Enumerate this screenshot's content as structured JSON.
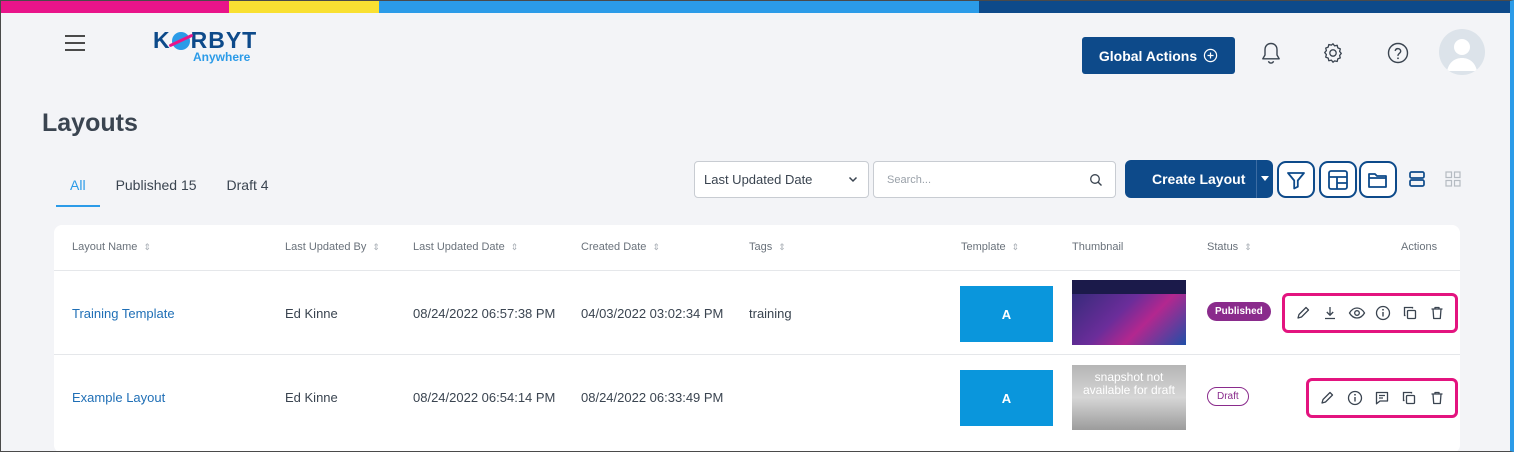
{
  "app": {
    "logo_text_left": "K",
    "logo_text_right": "RBYT",
    "logo_sub": "Anywhere",
    "brand_colors": [
      "#e9148a",
      "#f9e032",
      "#2b9be8",
      "#0d4a8a"
    ]
  },
  "header": {
    "global_actions_label": "Global Actions",
    "icons": [
      "menu-icon",
      "bell-icon",
      "gear-icon",
      "help-icon",
      "user-avatar-icon"
    ]
  },
  "page": {
    "title": "Layouts"
  },
  "tabs": [
    {
      "label": "All",
      "active": true
    },
    {
      "label": "Published 15",
      "active": false
    },
    {
      "label": "Draft 4",
      "active": false
    }
  ],
  "toolbar": {
    "sort_selected": "Last Updated Date",
    "search_placeholder": "Search...",
    "create_label": "Create Layout",
    "icons": [
      "filter-icon",
      "template-icon",
      "folder-icon",
      "list-view-icon",
      "grid-view-icon"
    ]
  },
  "table": {
    "columns": [
      "Layout Name",
      "Last Updated By",
      "Last Updated Date",
      "Created Date",
      "Tags",
      "Template",
      "Thumbnail",
      "Status",
      "Actions"
    ],
    "rows": [
      {
        "name": "Training Template",
        "updated_by": "Ed Kinne",
        "updated_date": "08/24/2022 06:57:38 PM",
        "created_date": "04/03/2022 03:02:34 PM",
        "tags": "training",
        "template": "A",
        "thumbnail_text": "",
        "status": "Published",
        "actions": [
          "edit-icon",
          "download-icon",
          "preview-icon",
          "info-icon",
          "copy-icon",
          "delete-icon"
        ]
      },
      {
        "name": "Example Layout",
        "updated_by": "Ed Kinne",
        "updated_date": "08/24/2022 06:54:14 PM",
        "created_date": "08/24/2022 06:33:49 PM",
        "tags": "",
        "template": "A",
        "thumbnail_text": "snapshot not available for draft",
        "status": "Draft",
        "actions": [
          "edit-icon",
          "info-icon",
          "comment-icon",
          "copy-icon",
          "delete-icon"
        ]
      }
    ]
  }
}
